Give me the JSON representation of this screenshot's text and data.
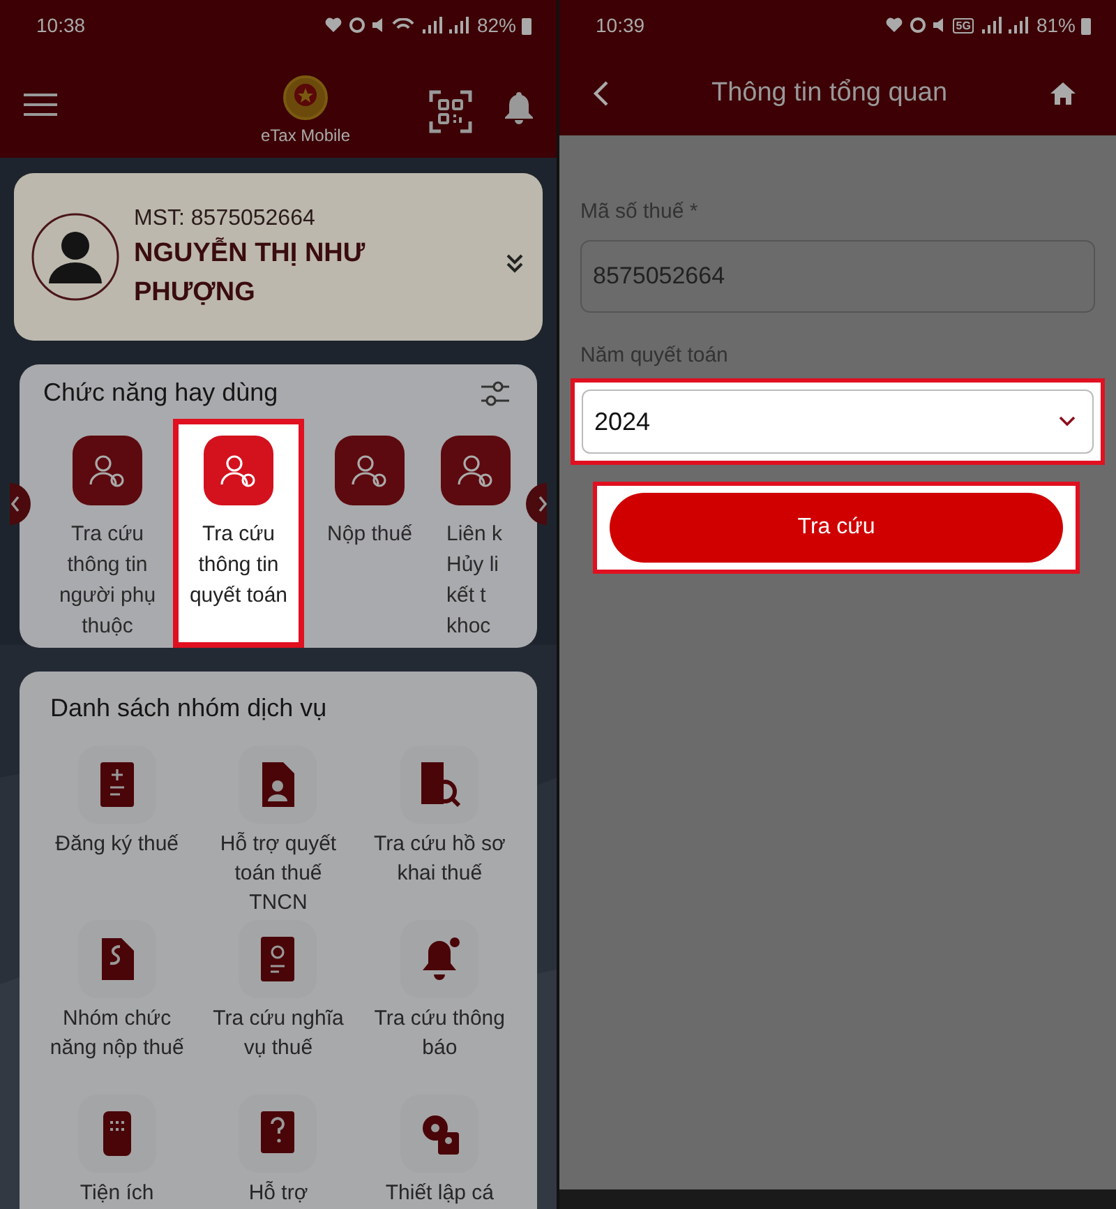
{
  "left_screen": {
    "status_bar": {
      "time": "10:38",
      "battery": "82%"
    },
    "header": {
      "app_name": "eTax Mobile"
    },
    "profile": {
      "tax_id": "MST: 8575052664",
      "name": "NGUYỄN THỊ NHƯ PHƯỢNG"
    },
    "favorites": {
      "title": "Chức năng hay dùng",
      "items": [
        {
          "label": "Tra cứu thông tin người phụ thuộc",
          "highlighted": false
        },
        {
          "label": "Tra cứu thông tin quyết toán",
          "highlighted": true
        },
        {
          "label": "Nộp thuế",
          "highlighted": false
        },
        {
          "label_lines": [
            "Liên k",
            "Hủy li",
            "kết t",
            "khoc"
          ],
          "highlighted": false
        }
      ]
    },
    "services": {
      "title": "Danh sách nhóm dịch vụ",
      "items": [
        {
          "label": "Đăng ký thuế",
          "kind": "register"
        },
        {
          "label": "Hỗ trợ quyết toán thuế TNCN",
          "kind": "document"
        },
        {
          "label": "Tra cứu hồ sơ khai thuế",
          "kind": "search"
        },
        {
          "label": "Nhóm chức năng nộp thuế",
          "kind": "payment"
        },
        {
          "label": "Tra cứu nghĩa vụ thuế",
          "kind": "book"
        },
        {
          "label": "Tra cứu thông báo",
          "kind": "bell"
        },
        {
          "label": "Tiện ích",
          "kind": "grid"
        },
        {
          "label": "Hỗ trợ",
          "kind": "help"
        },
        {
          "label": "Thiết lập cá",
          "kind": "settings"
        }
      ]
    }
  },
  "right_screen": {
    "status_bar": {
      "time": "10:39",
      "network": "5G",
      "battery": "81%"
    },
    "header": {
      "title": "Thông tin tổng quan"
    },
    "form": {
      "tax_id_label": "Mã số thuế",
      "tax_id_required": "*",
      "tax_id_value": "8575052664",
      "year_label": "Năm quyết toán",
      "year_value": "2024",
      "year_highlighted": true,
      "search_button": "Tra cứu",
      "button_highlighted": true
    }
  }
}
